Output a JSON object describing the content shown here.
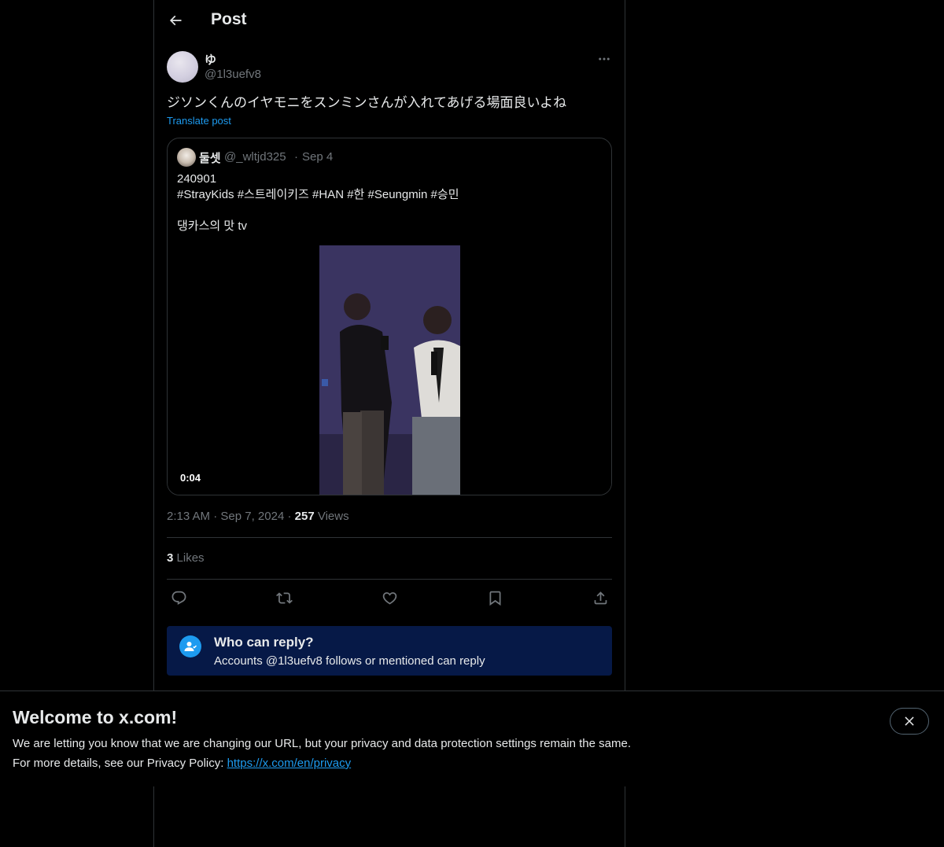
{
  "header": {
    "title": "Post",
    "back_icon": "arrow-left-icon"
  },
  "post": {
    "author": {
      "display_name": "ゆ",
      "handle": "@1l3uefv8"
    },
    "text": "ジソンくんのイヤモニをスンミンさんが入れてあげる場面良いよね",
    "translate_label": "Translate post",
    "quote": {
      "display_name": "둘셋",
      "handle": "@_wltjd325",
      "separator": "·",
      "date": "Sep 4",
      "lines": [
        "240901",
        "#StrayKids #스트레이키즈 #HAN #한 #Seungmin #승민",
        "",
        "댕카스의 맛 tv"
      ],
      "video_duration": "0:04"
    },
    "time": "2:13 AM",
    "separator": "·",
    "date": "Sep 7, 2024",
    "views_count": "257",
    "views_label": "Views",
    "likes_count": "3",
    "likes_label": "Likes"
  },
  "who_can_reply": {
    "title": "Who can reply?",
    "subtitle": "Accounts @1l3uefv8 follows or mentioned can reply"
  },
  "banner": {
    "title": "Welcome to x.com!",
    "line1": "We are letting you know that we are changing our URL, but your privacy and data protection settings remain the same.",
    "line2_prefix": "For more details, see our Privacy Policy: ",
    "link": "https://x.com/en/privacy"
  },
  "colors": {
    "accent": "#1d9bf0",
    "secondary_text": "#71767b",
    "border": "#2f3336",
    "reply_box_bg": "#061947"
  }
}
